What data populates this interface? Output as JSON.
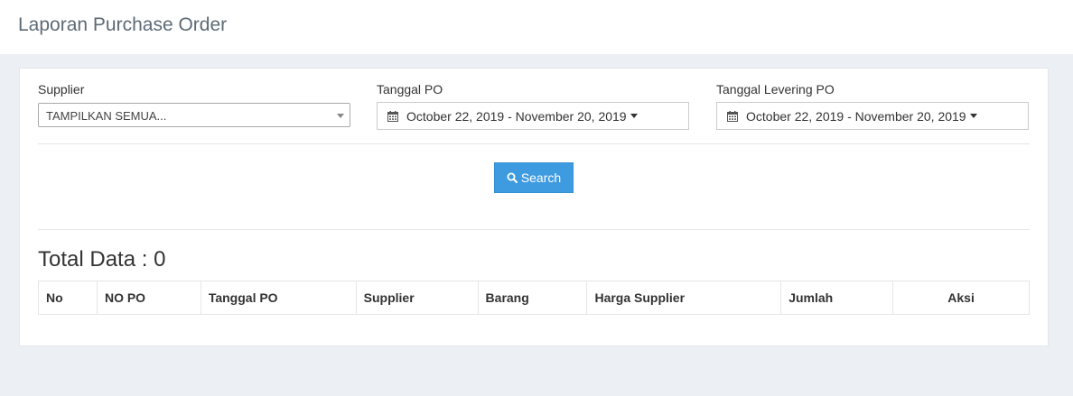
{
  "header": {
    "title": "Laporan Purchase Order"
  },
  "filters": {
    "supplier": {
      "label": "Supplier",
      "value": "TAMPILKAN SEMUA..."
    },
    "tanggal_po": {
      "label": "Tanggal PO",
      "value": "October 22, 2019 - November 20, 2019"
    },
    "tanggal_levering": {
      "label": "Tanggal Levering PO",
      "value": "October 22, 2019 - November 20, 2019"
    }
  },
  "search_button": {
    "label": "Search",
    "icon": "search-icon"
  },
  "total": {
    "text": "Total Data : 0"
  },
  "table": {
    "columns": [
      "No",
      "NO PO",
      "Tanggal PO",
      "Supplier",
      "Barang",
      "Harga Supplier",
      "Jumlah",
      "Aksi"
    ]
  },
  "colors": {
    "primary": "#3e9be0",
    "background": "#ecf0f5",
    "title": "#5d6a75"
  }
}
